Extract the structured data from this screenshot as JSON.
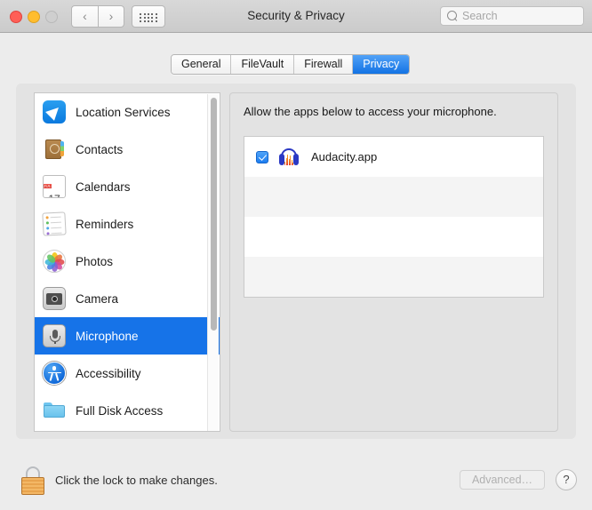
{
  "window": {
    "title": "Security & Privacy",
    "traffic_lights": [
      "close",
      "minimize",
      "zoom"
    ],
    "nav": {
      "back": "‹",
      "forward": "›"
    },
    "grid_button": "all-preferences"
  },
  "search": {
    "placeholder": "Search",
    "value": ""
  },
  "tabs": [
    {
      "label": "General",
      "selected": false
    },
    {
      "label": "FileVault",
      "selected": false
    },
    {
      "label": "Firewall",
      "selected": false
    },
    {
      "label": "Privacy",
      "selected": true
    }
  ],
  "sidebar": {
    "items": [
      {
        "label": "Location Services",
        "icon": "location-services-icon",
        "selected": false
      },
      {
        "label": "Contacts",
        "icon": "contacts-icon",
        "selected": false
      },
      {
        "label": "Calendars",
        "icon": "calendars-icon",
        "selected": false
      },
      {
        "label": "Reminders",
        "icon": "reminders-icon",
        "selected": false
      },
      {
        "label": "Photos",
        "icon": "photos-icon",
        "selected": false
      },
      {
        "label": "Camera",
        "icon": "camera-icon",
        "selected": false
      },
      {
        "label": "Microphone",
        "icon": "microphone-icon",
        "selected": true
      },
      {
        "label": "Accessibility",
        "icon": "accessibility-icon",
        "selected": false
      },
      {
        "label": "Full Disk Access",
        "icon": "folder-icon",
        "selected": false
      }
    ],
    "calendar_icon": {
      "month": "JUL",
      "day": "17"
    }
  },
  "detail": {
    "description": "Allow the apps below to access your microphone.",
    "apps": [
      {
        "name": "Audacity.app",
        "icon": "audacity-icon",
        "checked": true
      }
    ],
    "empty_rows": 4
  },
  "bottom": {
    "lock_icon": "lock-closed-icon",
    "lock_text": "Click the lock to make changes.",
    "advanced_label": "Advanced…",
    "advanced_enabled": false,
    "help_label": "?"
  },
  "colors": {
    "accent_blue": "#1673e8",
    "tab_selected_top": "#51a2f7",
    "tab_selected_bottom": "#1272e4",
    "window_bg": "#ececec",
    "titlebar_bg": "#cfcfcf",
    "panel_bg": "#e3e3e3",
    "list_bg": "#ffffff",
    "row_alt_bg": "#f4f4f4",
    "lock_gold": "#e8a34d"
  }
}
